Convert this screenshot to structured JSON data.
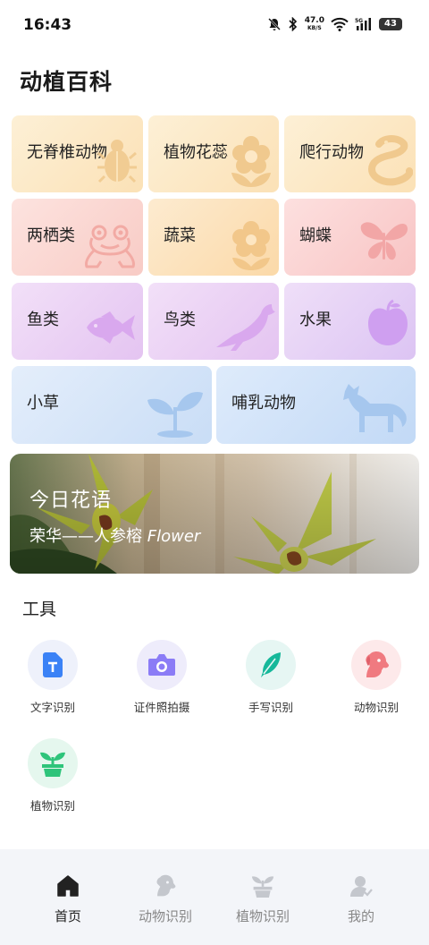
{
  "status_bar": {
    "time": "16:43",
    "net_speed_value": "47.0",
    "net_speed_unit": "KB/S",
    "signal_type": "5G",
    "battery": "43"
  },
  "app": {
    "title": "动植百科"
  },
  "categories": [
    {
      "label": "无脊椎动物",
      "icon": "beetle-icon",
      "color": "#fbe3b8"
    },
    {
      "label": "植物花蕊",
      "icon": "flower-icon",
      "color": "#fbe3b8"
    },
    {
      "label": "爬行动物",
      "icon": "snake-icon",
      "color": "#fbe3b8"
    },
    {
      "label": "两栖类",
      "icon": "frog-icon",
      "color": "#f7c8c0"
    },
    {
      "label": "蔬菜",
      "icon": "vegetable-flower-icon",
      "color": "#fbdcae"
    },
    {
      "label": "蝴蝶",
      "icon": "butterfly-icon",
      "color": "#f7c0c0"
    },
    {
      "label": "鱼类",
      "icon": "fish-icon",
      "color": "#e6c6f2"
    },
    {
      "label": "鸟类",
      "icon": "bird-icon",
      "color": "#e6c6f2"
    },
    {
      "label": "水果",
      "icon": "apple-icon",
      "color": "#dcc4f3"
    },
    {
      "label": "小草",
      "icon": "sprout-icon",
      "color": "#c9ddf6"
    },
    {
      "label": "哺乳动物",
      "icon": "fox-icon",
      "color": "#c2d9f6"
    }
  ],
  "banner": {
    "title": "今日花语",
    "subtitle": "荣华——人参榕 ",
    "subtitle_en": "Flower"
  },
  "tools": {
    "section_title": "工具",
    "items": [
      {
        "label": "文字识别",
        "icon": "text-recognition-icon",
        "color": "#3b82f6"
      },
      {
        "label": "证件照拍摄",
        "icon": "camera-icon",
        "color": "#8b7cf6"
      },
      {
        "label": "手写识别",
        "icon": "feather-icon",
        "color": "#16b89a"
      },
      {
        "label": "动物识别",
        "icon": "dog-icon",
        "color": "#f07a80"
      },
      {
        "label": "植物识别",
        "icon": "potted-plant-icon",
        "color": "#2ec47a"
      }
    ]
  },
  "nav": {
    "items": [
      {
        "label": "首页",
        "icon": "home-icon",
        "active": true
      },
      {
        "label": "动物识别",
        "icon": "dog-icon",
        "active": false
      },
      {
        "label": "植物识别",
        "icon": "plant-icon",
        "active": false
      },
      {
        "label": "我的",
        "icon": "user-icon",
        "active": false
      }
    ]
  }
}
